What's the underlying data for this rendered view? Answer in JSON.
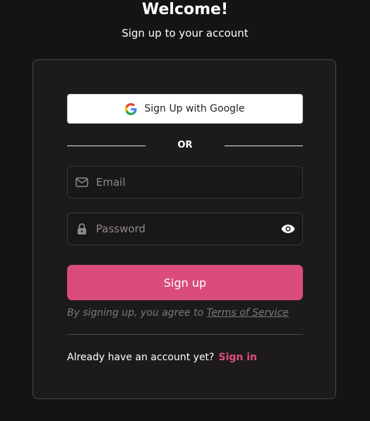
{
  "header": {
    "title": "Welcome!",
    "subtitle": "Sign up to your account"
  },
  "google_button": {
    "label": "Sign Up with Google",
    "icon": "google-icon"
  },
  "divider": {
    "label": "OR"
  },
  "email_field": {
    "placeholder": "Email",
    "value": "",
    "icon": "mail-icon"
  },
  "password_field": {
    "placeholder": "Password",
    "value": "",
    "icon": "lock-icon",
    "toggle_icon": "eye-icon"
  },
  "signup_button": {
    "label": "Sign up"
  },
  "terms": {
    "prefix": "By signing up, you agree to ",
    "link": "Terms of Service"
  },
  "signin": {
    "prompt": "Already have an account yet?",
    "link": "Sign in"
  },
  "colors": {
    "background": "#151414",
    "card": "#1d1b1a",
    "accent": "#d94c7b",
    "link_accent": "#e04d82"
  }
}
